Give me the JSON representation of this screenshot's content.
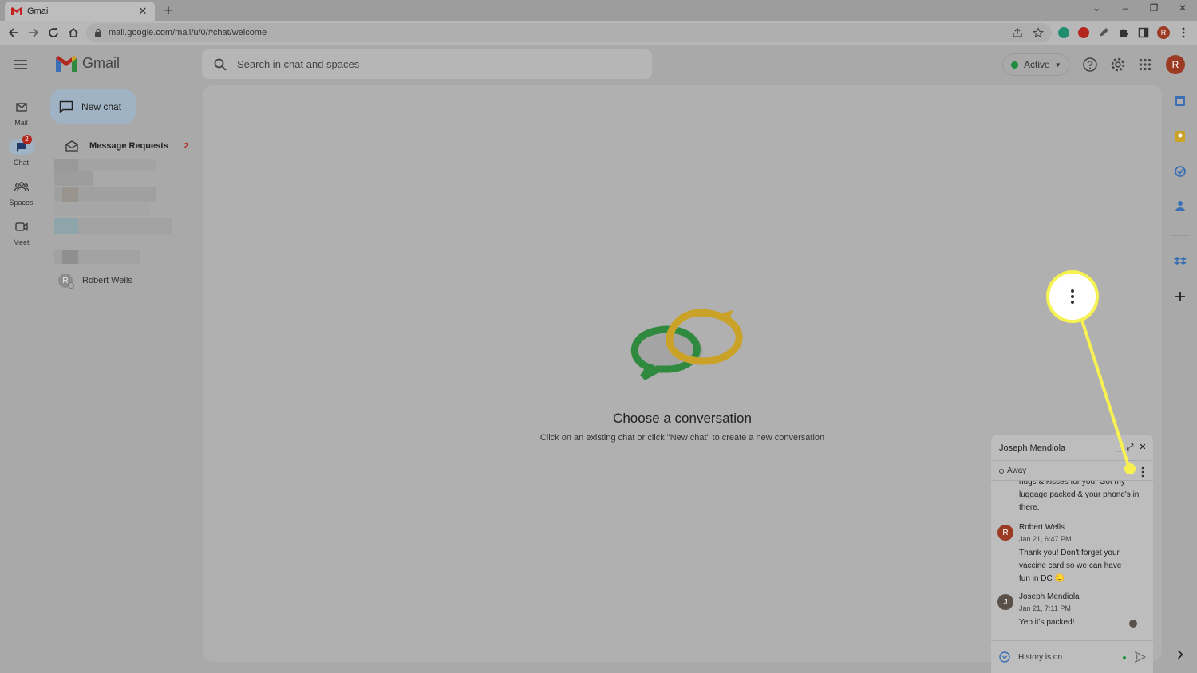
{
  "browser": {
    "tab_title": "Gmail",
    "url": "mail.google.com/mail/u/0/#chat/welcome"
  },
  "header": {
    "brand": "Gmail",
    "search_placeholder": "Search in chat and spaces",
    "status_label": "Active",
    "avatar_initial": "R"
  },
  "rail": {
    "mail": "Mail",
    "chat": "Chat",
    "chat_badge": "2",
    "spaces": "Spaces",
    "meet": "Meet"
  },
  "chatlist": {
    "new_chat": "New chat",
    "message_requests": "Message Requests",
    "message_requests_count": "2",
    "contact_name": "Robert Wells",
    "contact_initial": "R"
  },
  "main": {
    "title": "Choose a conversation",
    "subtitle": "Click on an existing chat or click \"New chat\" to create a new conversation"
  },
  "popup": {
    "title": "Joseph Mendiola",
    "status": "Away",
    "prev_message": "hugs & kisses for you. Got my luggage packed & your phone's in there.",
    "messages": [
      {
        "sender": "Robert Wells",
        "initial": "R",
        "time": "Jan 21, 6:47 PM",
        "text": "Thank you! Don't forget your vaccine card so we can have fun in DC 🙂"
      },
      {
        "sender": "Joseph Mendiola",
        "initial": "J",
        "time": "Jan 21, 7:11 PM",
        "text": "Yep it's packed!"
      }
    ],
    "history": "History is on"
  },
  "colors": {
    "highlight": "#f7f251",
    "active_green": "#1e8e3e",
    "badge_red": "#b3261e",
    "avatar_brown": "#9c3b24"
  }
}
